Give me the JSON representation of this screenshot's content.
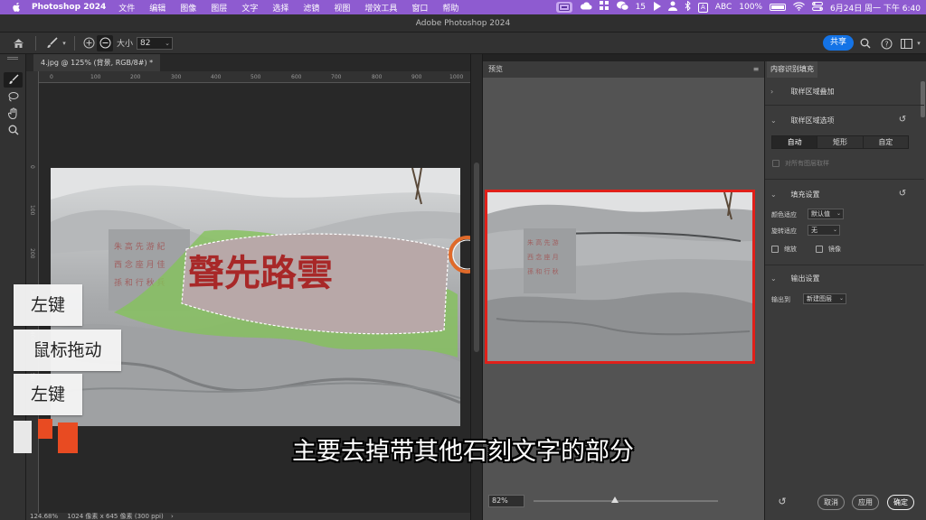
{
  "menubar": {
    "app_name": "Photoshop 2024",
    "items": [
      "文件",
      "编辑",
      "图像",
      "图层",
      "文字",
      "选择",
      "滤镜",
      "视图",
      "增效工具",
      "窗口",
      "帮助"
    ],
    "wechat_count": "15",
    "input_chip": "A",
    "input_method": "ABC",
    "battery": "100%",
    "datetime": "6月24日 周一 下午 6:40"
  },
  "window": {
    "title": "Adobe Photoshop 2024"
  },
  "options_bar": {
    "size_label": "大小",
    "size_value": "82",
    "share_label": "共享"
  },
  "document": {
    "tab_title": "4.jpg @ 125% (背景, RGB/8#) *",
    "ruler_top": [
      "0",
      "100",
      "200",
      "300",
      "400",
      "500",
      "600",
      "700",
      "800",
      "900",
      "1000"
    ],
    "ruler_left": [
      "0",
      "100",
      "200",
      "300",
      "400",
      "500"
    ],
    "status_zoom": "124.68%",
    "status_info": "1024 像素 x 645 像素 (300 ppi)",
    "status_caret": "›"
  },
  "preview": {
    "title": "预览",
    "zoom_value": "82%",
    "zoom_level": 0.44
  },
  "content_aware_fill": {
    "tab_title": "内容识别填充",
    "sample_overlay_title": "取样区域叠加",
    "sample_options_title": "取样区域选项",
    "sample_modes": [
      "自动",
      "矩形",
      "自定"
    ],
    "sample_all_layers": "对所有图层取样",
    "fill_settings_title": "填充设置",
    "color_adapt_label": "颜色适应",
    "color_adapt_value": "默认值",
    "rotation_adapt_label": "旋转适应",
    "rotation_adapt_value": "无",
    "scale_label": "缩放",
    "mirror_label": "镜像",
    "output_settings_title": "输出设置",
    "output_to_label": "输出到",
    "output_to_value": "新建图层",
    "cancel_label": "取消",
    "apply_label": "应用",
    "ok_label": "确定"
  },
  "overlay": {
    "labels": [
      "左键",
      "鼠标拖动",
      "左键"
    ],
    "subtitle": "主要去掉带其他石刻文字的部分"
  },
  "colors": {
    "menubar_bg": "#8e5bd0",
    "accent_blue": "#1473e6",
    "highlight_red": "#e0201a",
    "selection_green": "#84c35a",
    "cursor_orange": "#e06a2a"
  }
}
